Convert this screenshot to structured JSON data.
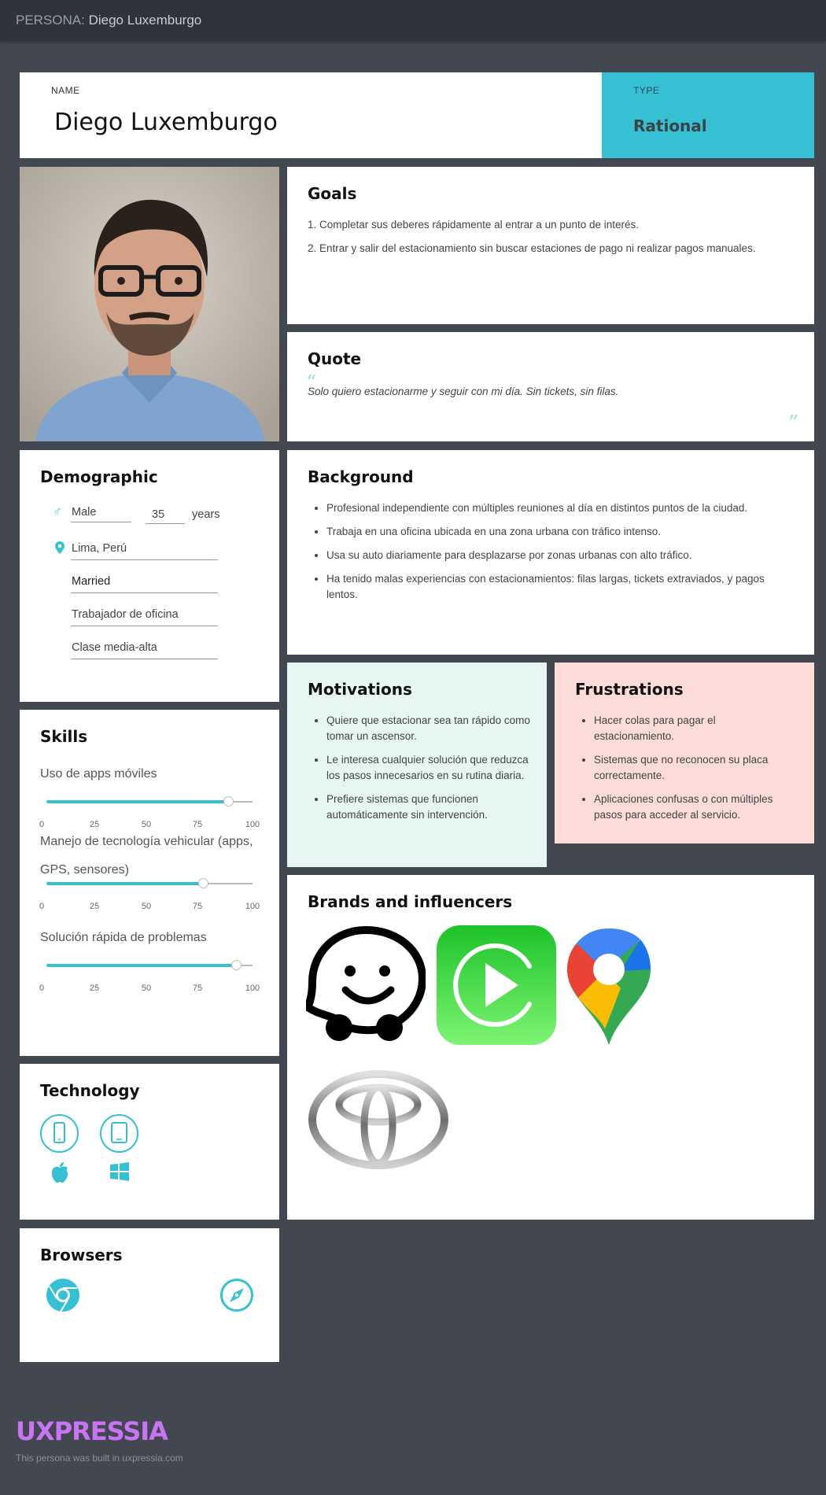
{
  "header": {
    "prefix": "PERSONA:",
    "name": "Diego Luxemburgo"
  },
  "name_card": {
    "label": "NAME",
    "value": "Diego Luxemburgo"
  },
  "type_card": {
    "label": "TYPE",
    "value": "Rational"
  },
  "goals": {
    "title": "Goals",
    "items": [
      "1. Completar sus deberes rápidamente al entrar a un punto de interés.",
      "2. Entrar y salir del estacionamiento sin buscar estaciones de pago ni realizar pagos manuales."
    ]
  },
  "quote": {
    "title": "Quote",
    "text": "Solo quiero estacionarme y seguir con mi día. Sin tickets, sin filas."
  },
  "demographic": {
    "title": "Demographic",
    "gender": "Male",
    "age": "35",
    "age_unit": "years",
    "location": "Lima, Perú",
    "status": "Married",
    "occupation": "Trabajador de oficina",
    "class": "Clase media-alta"
  },
  "background": {
    "title": "Background",
    "items": [
      "Profesional independiente con múltiples reuniones al día en distintos puntos de la ciudad.",
      "Trabaja en una oficina ubicada en una zona urbana con tráfico intenso.",
      "Usa su auto diariamente para desplazarse por zonas urbanas con alto tráfico.",
      "Ha tenido malas experiencias con estacionamientos: filas largas, tickets extraviados, y pagos lentos."
    ]
  },
  "motivations": {
    "title": "Motivations",
    "items": [
      "Quiere que estacionar sea tan rápido como tomar un ascensor.",
      "Le interesa cualquier solución que reduzca los pasos innecesarios en su rutina diaria.",
      "Prefiere sistemas que funcionen automáticamente sin intervención."
    ]
  },
  "frustrations": {
    "title": "Frustrations",
    "items": [
      "Hacer colas para pagar el estacionamiento.",
      "Sistemas que no reconocen su placa correctamente.",
      "Aplicaciones confusas o con múltiples pasos para acceder al servicio."
    ]
  },
  "skills": {
    "title": "Skills",
    "tick_labels": [
      "0",
      "25",
      "50",
      "75",
      "100"
    ],
    "items": [
      {
        "label": "Uso de apps móviles",
        "value": 88
      },
      {
        "label": "Manejo de tecnología vehicular (apps, GPS, sensores)",
        "value": 76
      },
      {
        "label": "Solución rápida de problemas",
        "value": 92
      }
    ]
  },
  "technology": {
    "title": "Technology",
    "icons": [
      "smartphone-icon",
      "tablet-icon",
      "apple-icon",
      "windows-icon"
    ]
  },
  "browsers": {
    "title": "Browsers",
    "icons": [
      "chrome-icon",
      "safari-icon"
    ]
  },
  "brands": {
    "title": "Brands and influencers",
    "logos": [
      "waze-logo",
      "carplay-logo",
      "google-maps-logo",
      "toyota-logo"
    ]
  },
  "colors": {
    "accent": "#35c0d3",
    "motivations_bg": "#e6f7f3",
    "frustrations_bg": "#fbdcd9",
    "brand_logo": "#c874f5"
  },
  "footer": {
    "logo": "UXPRESSIA",
    "note": "This persona was built in uxpressia.com"
  }
}
